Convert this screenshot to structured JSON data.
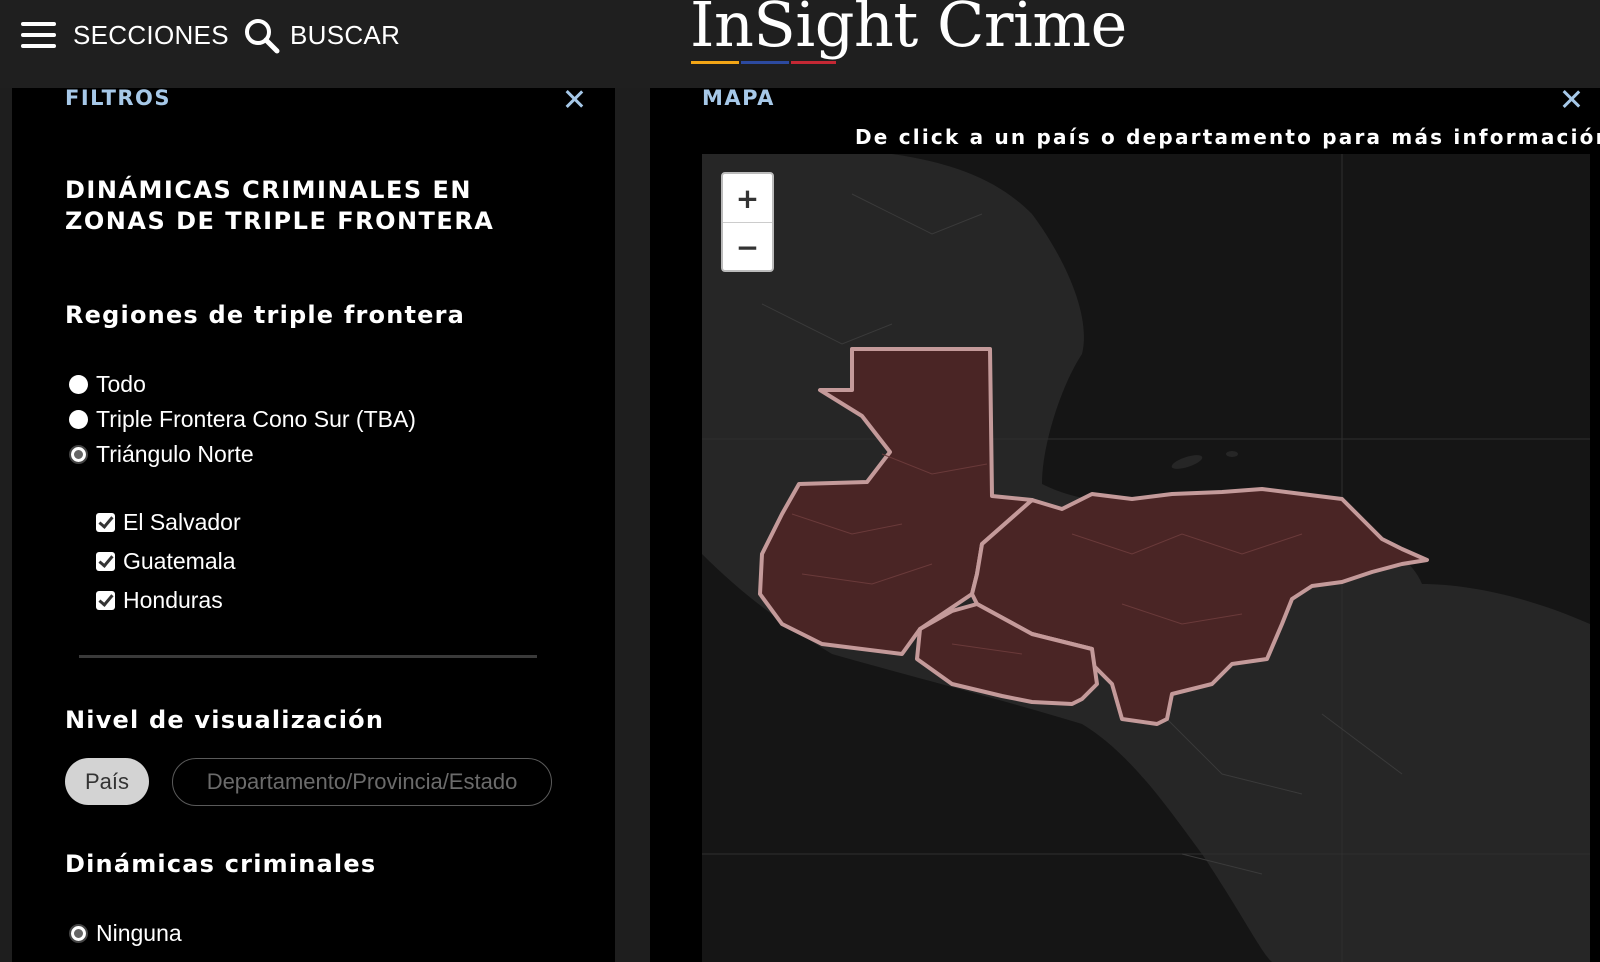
{
  "header": {
    "menu_label": "SECCIONES",
    "search_label": "BUSCAR",
    "logo_text": "InSight Crime",
    "logo_underline_colors": [
      "#f2a516",
      "#2c4aa0",
      "#c42834"
    ]
  },
  "filters": {
    "panel_label": "FILTROS",
    "title": "DINÁMICAS CRIMINALES EN ZONAS DE TRIPLE FRONTERA",
    "regions": {
      "heading": "Regiones de triple frontera",
      "options": [
        {
          "label": "Todo",
          "selected": false
        },
        {
          "label": "Triple Frontera Cono Sur (TBA)",
          "selected": false
        },
        {
          "label": "Triángulo Norte",
          "selected": true
        }
      ],
      "countries": [
        {
          "label": "El Salvador",
          "checked": true
        },
        {
          "label": "Guatemala",
          "checked": true
        },
        {
          "label": "Honduras",
          "checked": true
        }
      ]
    },
    "visualization": {
      "heading": "Nivel de visualización",
      "options": [
        "País",
        "Departamento/Provincia/Estado"
      ],
      "selected": "País"
    },
    "dynamics": {
      "heading": "Dinámicas criminales",
      "options": [
        {
          "label": "Ninguna",
          "selected": true
        }
      ]
    }
  },
  "map": {
    "panel_label": "MAPA",
    "hint": "De click a un país o departamento para más información",
    "zoom_in": "+",
    "zoom_out": "−",
    "highlighted_countries": [
      "Guatemala",
      "Honduras",
      "El Salvador"
    ],
    "colors": {
      "land": "#262626",
      "water": "#141414",
      "country_fill": "#4a2525",
      "country_border": "#c49a9a",
      "accent_label": "#a6c8e8"
    }
  }
}
